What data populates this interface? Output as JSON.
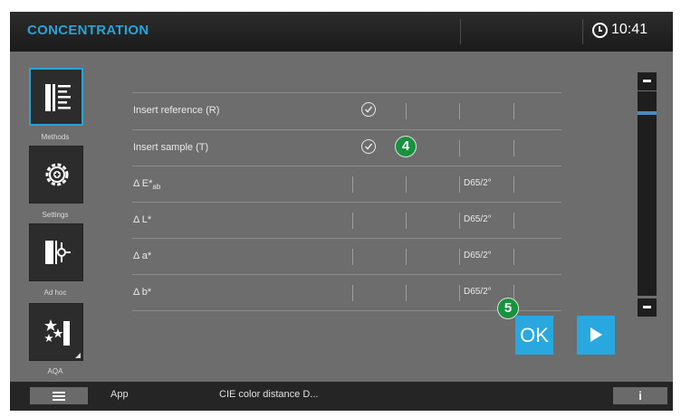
{
  "header": {
    "title": "CONCENTRATION",
    "time": "10:41"
  },
  "sidebar": {
    "items": [
      {
        "label": "Methods",
        "icon": "methods-list-icon",
        "active": true
      },
      {
        "label": "Settings",
        "icon": "gear-icon"
      },
      {
        "label": "Ad hoc",
        "icon": "ad-hoc-icon"
      },
      {
        "label": "AQA",
        "icon": "stars-icon"
      }
    ]
  },
  "table": {
    "rows": [
      {
        "label": "Insert reference (R)",
        "status": "done"
      },
      {
        "label": "Insert sample (T)",
        "status": "done"
      },
      {
        "label": "Δ E*",
        "sub": "ab",
        "unit": "D65/2°"
      },
      {
        "label": "Δ L*",
        "unit": "D65/2°"
      },
      {
        "label": "Δ a*",
        "unit": "D65/2°"
      },
      {
        "label": "Δ b*",
        "unit": "D65/2°"
      }
    ]
  },
  "callouts": [
    "4",
    "5"
  ],
  "actions": {
    "ok_label": "OK",
    "next_icon": "play-icon"
  },
  "bottombar": {
    "app_label": "App",
    "status_text": "CIE color distance D...",
    "info_label": "i"
  },
  "colors": {
    "accent": "#29a3d9",
    "badge": "#17923e",
    "background": "#6d6d6d"
  }
}
